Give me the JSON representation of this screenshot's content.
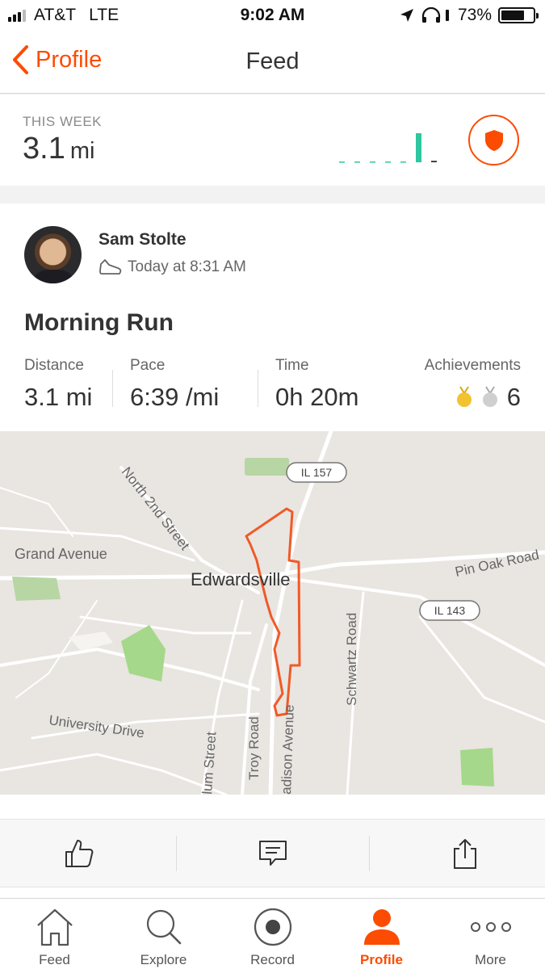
{
  "status": {
    "carrier": "AT&T",
    "network": "LTE",
    "time": "9:02 AM",
    "battery": "73%",
    "battery_level": 0.73
  },
  "nav": {
    "back_label": "Profile",
    "title": "Feed"
  },
  "this_week": {
    "label": "THIS WEEK",
    "distance_value": "3.1",
    "distance_unit": "mi",
    "daily_bars": [
      0,
      0,
      0,
      0,
      0,
      1,
      0.05
    ],
    "accent": "#2fc6a0"
  },
  "activity": {
    "athlete": "Sam Stolte",
    "time": "Today at 8:31 AM",
    "title": "Morning Run",
    "stats": {
      "distance_label": "Distance",
      "distance_value": "3.1 mi",
      "pace_label": "Pace",
      "pace_value": "6:39 /mi",
      "time_label": "Time",
      "time_value": "0h 20m",
      "achievements_label": "Achievements",
      "achievements_value": "6"
    },
    "map_labels": {
      "il157": "IL 157",
      "il143": "IL 143",
      "north2nd": "North 2nd Street",
      "grand": "Grand Avenue",
      "city": "Edwardsville",
      "pinoak": "Pin Oak Road",
      "schwartz": "Schwartz Road",
      "university": "University Drive",
      "elm": "lum Street",
      "troy": "Troy Road",
      "madison": "adison Avenue"
    }
  },
  "tabs": [
    {
      "label": "Feed",
      "icon": "home-icon"
    },
    {
      "label": "Explore",
      "icon": "search-icon"
    },
    {
      "label": "Record",
      "icon": "record-icon"
    },
    {
      "label": "Profile",
      "icon": "profile-icon"
    },
    {
      "label": "More",
      "icon": "more-icon"
    }
  ],
  "colors": {
    "brand": "#fc4c02",
    "route": "#f05a28"
  }
}
